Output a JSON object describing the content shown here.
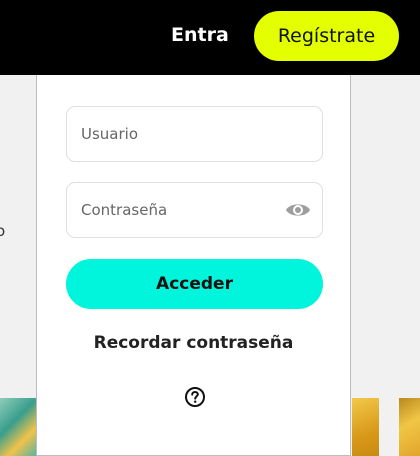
{
  "header": {
    "login_label": "Entra",
    "register_label": "Regístrate"
  },
  "background": {
    "fragment_text": "o"
  },
  "login_panel": {
    "username_placeholder": "Usuario",
    "password_placeholder": "Contraseña",
    "show_password_icon": "eye-icon",
    "submit_label": "Acceder",
    "forgot_password_label": "Recordar contraseña",
    "help_icon": "question-circle-icon"
  },
  "colors": {
    "topbar": "#000000",
    "register_button": "#e3ff00",
    "submit_button": "#00f5dc"
  }
}
